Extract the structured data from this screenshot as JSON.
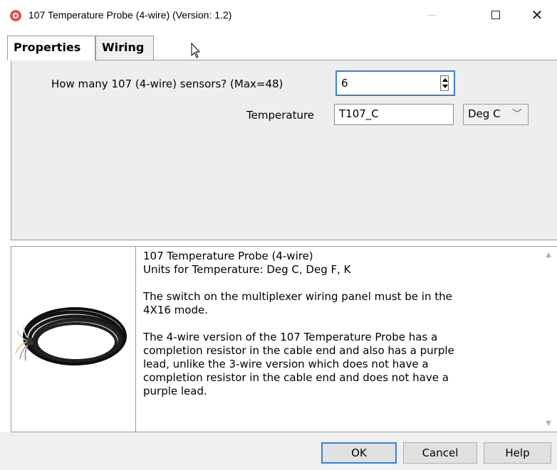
{
  "window": {
    "title": "107 Temperature Probe (4-wire) (Version: 1.2)",
    "icon": "app-logo-icon"
  },
  "tabs": [
    {
      "label": "Properties",
      "selected": true
    },
    {
      "label": "Wiring",
      "selected": false
    }
  ],
  "form": {
    "count_label": "How many 107 (4-wire) sensors? (Max=48)",
    "count_value": "6",
    "temperature_label": "Temperature",
    "temperature_value": "T107_C",
    "unit_selected": "Deg C"
  },
  "description": {
    "lines": [
      "107 Temperature Probe (4-wire)",
      "Units for Temperature: Deg C, Deg F, K",
      "",
      "The switch on the multiplexer wiring panel must be in the",
      "4X16 mode.",
      "",
      "The 4-wire version of the 107 Temperature Probe has a",
      "completion resistor in the cable end and also has a purple",
      "lead, unlike the 3-wire version which does not have a",
      "completion resistor in the cable end and does not have a",
      "purple lead."
    ]
  },
  "buttons": {
    "ok": "OK",
    "cancel": "Cancel",
    "help": "Help"
  },
  "colors": {
    "focus_border": "#3c7fd6",
    "panel_bg": "#eeeeee"
  }
}
